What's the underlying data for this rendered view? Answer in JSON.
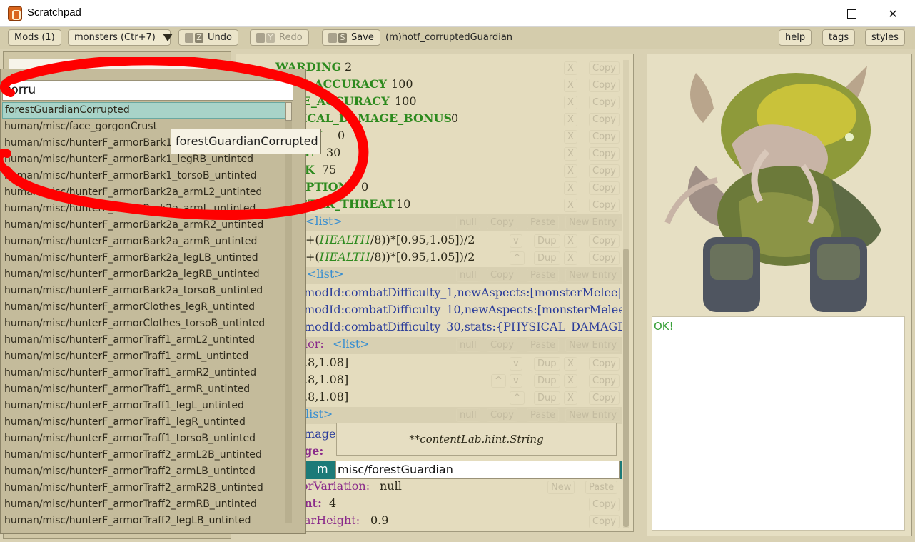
{
  "window": {
    "title": "Scratchpad",
    "close_glyph": "✕"
  },
  "toolbar": {
    "mods_label": "Mods (1)",
    "dropdown_label": "monsters (Ctr+7)",
    "undo_key": "Z",
    "undo_label": "Undo",
    "redo_key": "Y",
    "redo_label": "Redo",
    "save_key": "S",
    "save_label": "Save",
    "path": "(m)hotf_corruptedGuardian",
    "help_label": "help",
    "tags_label": "tags",
    "styles_label": "styles"
  },
  "popup": {
    "search_value": "corru",
    "items": [
      "forestGuardianCorrupted",
      "human/misc/face_gorgonCrust",
      "human/misc/hunterF_armorBark1_legLB_untinted",
      "human/misc/hunterF_armorBark1_legRB_untinted",
      "human/misc/hunterF_armorBark1_torsoB_untinted",
      "human/misc/hunterF_armorBark2a_armL2_untinted",
      "human/misc/hunterF_armorBark2a_armL_untinted",
      "human/misc/hunterF_armorBark2a_armR2_untinted",
      "human/misc/hunterF_armorBark2a_armR_untinted",
      "human/misc/hunterF_armorBark2a_legLB_untinted",
      "human/misc/hunterF_armorBark2a_legRB_untinted",
      "human/misc/hunterF_armorBark2a_torsoB_untinted",
      "human/misc/hunterF_armorClothes_legR_untinted",
      "human/misc/hunterF_armorClothes_torsoB_untinted",
      "human/misc/hunterF_armorTraff1_armL2_untinted",
      "human/misc/hunterF_armorTraff1_armL_untinted",
      "human/misc/hunterF_armorTraff1_armR2_untinted",
      "human/misc/hunterF_armorTraff1_armR_untinted",
      "human/misc/hunterF_armorTraff1_legL_untinted",
      "human/misc/hunterF_armorTraff1_legR_untinted",
      "human/misc/hunterF_armorTraff1_torsoB_untinted",
      "human/misc/hunterF_armorTraff2_armL2B_untinted",
      "human/misc/hunterF_armorTraff2_armLB_untinted",
      "human/misc/hunterF_armorTraff2_armR2B_untinted",
      "human/misc/hunterF_armorTraff2_armRB_untinted",
      "human/misc/hunterF_armorTraff2_legLB_untinted"
    ],
    "tooltip": "forestGuardianCorrupted"
  },
  "editor": {
    "rows": [
      {
        "key": "WARDING",
        "value": "2"
      },
      {
        "key": "E_ACCURACY",
        "value": "100"
      },
      {
        "key": "GE_ACCURACY",
        "value": "100"
      },
      {
        "key": "ICAL_DAMAGE_BONUS",
        "value": "0"
      },
      {
        "key": "CY",
        "value": "0"
      },
      {
        "key": "E",
        "value": "30"
      },
      {
        "key": "K",
        "value": "75"
      },
      {
        "key": "EPTION",
        "value": "0"
      },
      {
        "key": "STER_THREAT",
        "value": "10"
      }
    ],
    "list_tag": "<list>",
    "formula_prefix": "+(",
    "formula_health": "HEALTH",
    "formula_suffix": "/8))*[0.95,1.05])/2",
    "list_tag2": "<list>",
    "mod_rows": [
      "modId:combatDifficulty_1,newAspects:[monsterMelee|sto",
      "modId:combatDifficulty_10,newAspects:[monsterMelee|st",
      "modId:combatDifficulty_30,stats:{PHYSICAL_DAMAGE_BO"
    ],
    "color_key": "lor:",
    "list_tag3": "<list>",
    "color_rows": [
      ".8,1.08]",
      ".8,1.08]",
      ".8,1.08]"
    ],
    "list_tag4": "list>",
    "image_key": "mage",
    "age_key": "ge:",
    "edit_prefix": "m",
    "edit_value": "misc/forestGuardian",
    "hint": "**contentLab.hint.String",
    "color_variation_key": "orVariation:",
    "color_variation_value": "null",
    "nt_key": "nt:",
    "nt_value": "4",
    "bar_height_key": "arHeight:",
    "bar_height_value": "0.9",
    "ghost": {
      "x": "X",
      "copy": "Copy",
      "null": "null",
      "paste": "Paste",
      "new_entry": "New Entry",
      "dup": "Dup",
      "v": "v",
      "up": "^",
      "new": "New"
    }
  },
  "console": {
    "text": "OK!"
  },
  "colors": {
    "key_green": "#2d8a1e",
    "list_blue": "#3a8fd0",
    "annotation_red": "#ff0000"
  }
}
